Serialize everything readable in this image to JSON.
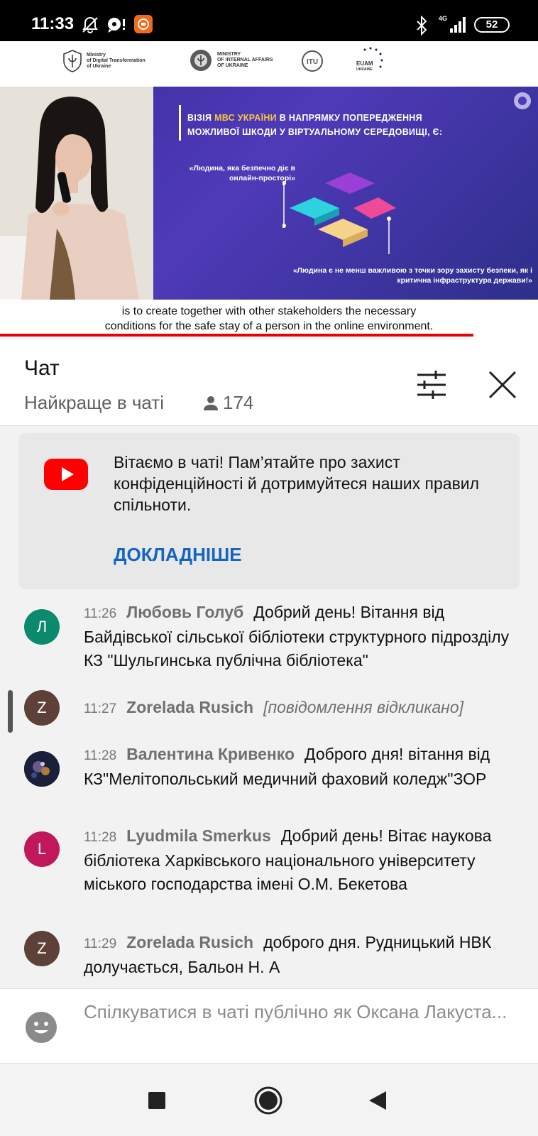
{
  "status_bar": {
    "time": "11:33",
    "network": "4G",
    "battery": "52",
    "icons": [
      "bell-off-icon",
      "chat-icon",
      "app-icon",
      "bluetooth-icon",
      "signal-icon",
      "battery-icon"
    ]
  },
  "video": {
    "logos": [
      {
        "name": "Ministry of Digital Transformation of Ukraine",
        "lines": [
          "Ministry",
          "of Digital Transformation",
          "of Ukraine"
        ]
      },
      {
        "name": "Ministry of Internal Affairs of Ukraine",
        "lines": [
          "MINISTRY",
          "OF INTERNAL AFFAIRS",
          "OF UKRAINE"
        ]
      },
      {
        "name": "ITU",
        "lines": [
          "ITU"
        ]
      },
      {
        "name": "EUAM",
        "lines": [
          "EUAM",
          "UKRAINE"
        ]
      }
    ],
    "slide": {
      "title_pre": "ВІЗІЯ ",
      "title_highlight": "МВС УКРАЇНИ",
      "title_post": " В НАПРЯМКУ ПОПЕРЕДЖЕННЯ МОЖЛИВОЇ ШКОДИ У ВІРТУАЛЬНОМУ СЕРЕДОВИЩІ, Є:",
      "quote1": "«Людина, яка безпечно діє в онлайн-просторі»",
      "quote2": "«Людина є не менш важливою з точки зору захисту безпеки, як і критична інфраструктура держави!»"
    },
    "subtitle_line1": "is to create together with other stakeholders the necessary",
    "subtitle_line2": "conditions for the safe stay of a person in the online environment.",
    "progress_fraction": 0.88,
    "colors": {
      "progress": "#ee0000",
      "highlight": "#f4c542"
    }
  },
  "chat": {
    "title": "Чат",
    "filter": "Найкраще в чаті",
    "viewers": "174",
    "icons": [
      "person-icon",
      "filter-sliders-icon",
      "close-icon"
    ]
  },
  "welcome": {
    "text": "Вітаємо в чаті! Пам’ятайте про захист конфіденційності й дотримуйтеся наших правил спільноти.",
    "link": "ДОКЛАДНІШЕ"
  },
  "messages": [
    {
      "time": "11:26",
      "author": "Любовь Голуб",
      "text": "Добрий день! Вітання від Байдівської сільської бібліотеки структурного підрозділу КЗ \"Шульгинська публічна бібліотека\"",
      "avatar_letter": "Л",
      "avatar_color": "#0b8a6e",
      "deleted": false
    },
    {
      "time": "11:27",
      "author": "Zorelada Rusich",
      "text": "[повідомлення відкликано]",
      "avatar_letter": "Z",
      "avatar_color": "#5d4037",
      "deleted": true
    },
    {
      "time": "11:28",
      "author": "Валентина Кривенко",
      "text": "Доброго дня! вітання від КЗ\"Мелітопольський медичний фаховий коледж\"ЗОР",
      "avatar_letter": "",
      "avatar_color": "#1a1f3a",
      "deleted": false
    },
    {
      "time": "11:28",
      "author": "Lyudmila Smerkus",
      "text": "Добрий день! Вітає наукова бібліотека Харківського національного університету міського господарства імені О.М. Бекетова",
      "avatar_letter": "L",
      "avatar_color": "#c2185b",
      "deleted": false
    },
    {
      "time": "11:29",
      "author": "Zorelada Rusich",
      "text": "доброго дня. Рудницький НВК долучається, Бальон Н. А",
      "avatar_letter": "Z",
      "avatar_color": "#5d4037",
      "deleted": false
    }
  ],
  "input": {
    "placeholder": "Спілкуватися в чаті публічно як Оксана Лакуста..."
  },
  "nav": {
    "icons": [
      "recents-square-icon",
      "home-circle-icon",
      "back-triangle-icon"
    ]
  }
}
